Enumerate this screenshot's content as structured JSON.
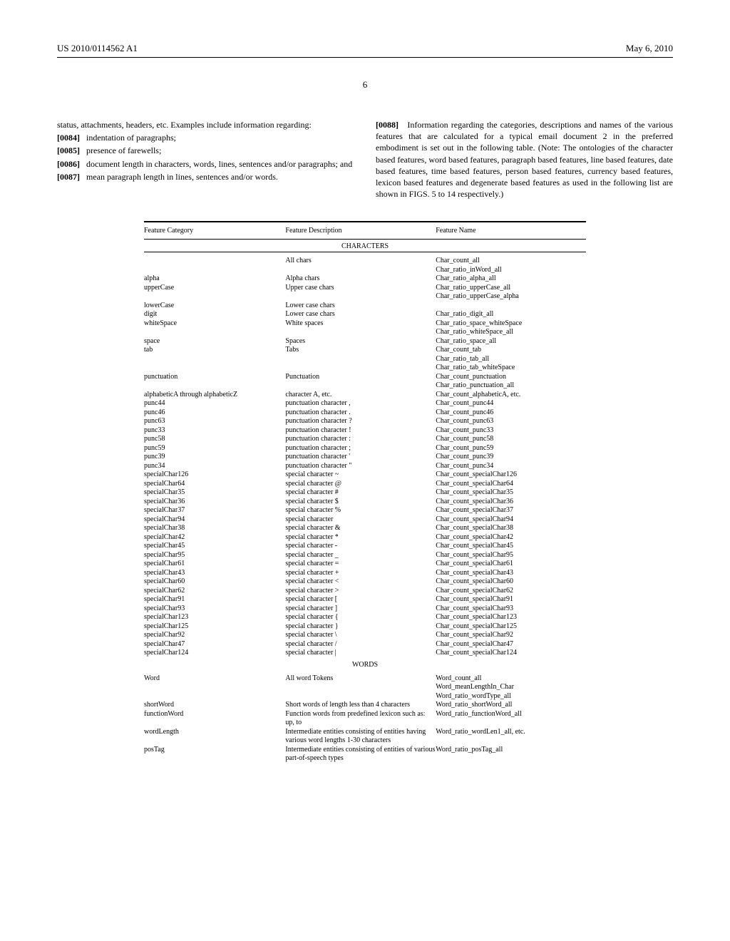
{
  "header": {
    "pub_number": "US 2010/0114562 A1",
    "pub_date": "May 6, 2010"
  },
  "page_number": "6",
  "left_column": {
    "intro": "status, attachments, headers, etc. Examples include information regarding:",
    "items": [
      {
        "num": "[0084]",
        "text": "indentation of paragraphs;"
      },
      {
        "num": "[0085]",
        "text": "presence of farewells;"
      },
      {
        "num": "[0086]",
        "text": "document length in characters, words, lines, sentences and/or paragraphs; and"
      },
      {
        "num": "[0087]",
        "text": "mean paragraph length in lines, sentences and/or words."
      }
    ]
  },
  "right_column": {
    "num": "[0088]",
    "text": "Information regarding the categories, descriptions and names of the various features that are calculated for a typical email document 2 in the preferred embodiment is set out in the following table. (Note: The ontologies of the character based features, word based features, paragraph based features, line based features, date based features, time based features, person based features, currency based features, lexicon based features and degenerate based features as used in the following list are shown in FIGS. 5 to 14 respectively.)"
  },
  "table": {
    "headers": {
      "cat": "Feature Category",
      "desc": "Feature Description",
      "name": "Feature Name"
    },
    "section_characters": "CHARACTERS",
    "section_words": "WORDS",
    "rows_characters": [
      {
        "cat": "",
        "desc": "All chars",
        "name": "Char_count_all"
      },
      {
        "cat": "",
        "desc": "",
        "name": "Char_ratio_inWord_all"
      },
      {
        "cat": "alpha",
        "desc": "Alpha chars",
        "name": "Char_ratio_alpha_all"
      },
      {
        "cat": "upperCase",
        "desc": "Upper case chars",
        "name": "Char_ratio_upperCase_all"
      },
      {
        "cat": "",
        "desc": "",
        "name": "Char_ratio_upperCase_alpha"
      },
      {
        "cat": "lowerCase",
        "desc": "Lower case chars",
        "name": ""
      },
      {
        "cat": "digit",
        "desc": "Lower case chars",
        "name": "Char_ratio_digit_all"
      },
      {
        "cat": "whiteSpace",
        "desc": "White spaces",
        "name": "Char_ratio_space_whiteSpace"
      },
      {
        "cat": "",
        "desc": "",
        "name": "Char_ratio_whiteSpace_all"
      },
      {
        "cat": "space",
        "desc": "Spaces",
        "name": "Char_ratio_space_all"
      },
      {
        "cat": "tab",
        "desc": "Tabs",
        "name": "Char_count_tab"
      },
      {
        "cat": "",
        "desc": "",
        "name": "Char_ratio_tab_all"
      },
      {
        "cat": "",
        "desc": "",
        "name": "Char_ratio_tab_whiteSpace"
      },
      {
        "cat": "punctuation",
        "desc": "Punctuation",
        "name": "Char_count_punctuation"
      },
      {
        "cat": "",
        "desc": "",
        "name": "Char_ratio_punctuation_all"
      },
      {
        "cat": "alphabeticA through alphabeticZ",
        "desc": "character A, etc.",
        "name": "Char_count_alphabeticA, etc."
      },
      {
        "cat": "punc44",
        "desc": "punctuation character ,",
        "name": "Char_count_punc44"
      },
      {
        "cat": "punc46",
        "desc": "punctuation character .",
        "name": "Char_count_punc46"
      },
      {
        "cat": "punc63",
        "desc": "punctuation character ?",
        "name": "Char_count_punc63"
      },
      {
        "cat": "punc33",
        "desc": "punctuation character !",
        "name": "Char_count_punc33"
      },
      {
        "cat": "punc58",
        "desc": "punctuation character :",
        "name": "Char_count_punc58"
      },
      {
        "cat": "punc59",
        "desc": "punctuation character ;",
        "name": "Char_count_punc59"
      },
      {
        "cat": "punc39",
        "desc": "punctuation character '",
        "name": "Char_count_punc39"
      },
      {
        "cat": "punc34",
        "desc": "punctuation character \"",
        "name": "Char_count_punc34"
      },
      {
        "cat": "specialChar126",
        "desc": "special character ~",
        "name": "Char_count_specialChar126"
      },
      {
        "cat": "specialChar64",
        "desc": "special character @",
        "name": "Char_count_specialChar64"
      },
      {
        "cat": "specialChar35",
        "desc": "special character #",
        "name": "Char_count_specialChar35"
      },
      {
        "cat": "specialChar36",
        "desc": "special character $",
        "name": "Char_count_specialChar36"
      },
      {
        "cat": "specialChar37",
        "desc": "special character %",
        "name": "Char_count_specialChar37"
      },
      {
        "cat": "specialChar94",
        "desc": "special character",
        "name": "Char_count_specialChar94"
      },
      {
        "cat": "specialChar38",
        "desc": "special character &",
        "name": "Char_count_specialChar38"
      },
      {
        "cat": "specialChar42",
        "desc": "special character *",
        "name": "Char_count_specialChar42"
      },
      {
        "cat": "specialChar45",
        "desc": "special character -",
        "name": "Char_count_specialChar45"
      },
      {
        "cat": "specialChar95",
        "desc": "special character _",
        "name": "Char_count_specialChar95"
      },
      {
        "cat": "specialChar61",
        "desc": "special character =",
        "name": "Char_count_specialChar61"
      },
      {
        "cat": "specialChar43",
        "desc": "special character +",
        "name": "Char_count_specialChar43"
      },
      {
        "cat": "specialChar60",
        "desc": "special character <",
        "name": "Char_count_specialChar60"
      },
      {
        "cat": "specialChar62",
        "desc": "special character >",
        "name": "Char_count_specialChar62"
      },
      {
        "cat": "specialChar91",
        "desc": "special character [",
        "name": "Char_count_specialChar91"
      },
      {
        "cat": "specialChar93",
        "desc": "special character ]",
        "name": "Char_count_specialChar93"
      },
      {
        "cat": "specialChar123",
        "desc": "special character {",
        "name": "Char_count_specialChar123"
      },
      {
        "cat": "specialChar125",
        "desc": "special character }",
        "name": "Char_count_specialChar125"
      },
      {
        "cat": "specialChar92",
        "desc": "special character \\",
        "name": "Char_count_specialChar92"
      },
      {
        "cat": "specialChar47",
        "desc": "special character /",
        "name": "Char_count_specialChar47"
      },
      {
        "cat": "specialChar124",
        "desc": "special character |",
        "name": "Char_count_specialChar124"
      }
    ],
    "rows_words": [
      {
        "cat": "Word",
        "desc": "All word Tokens",
        "name": "Word_count_all"
      },
      {
        "cat": "",
        "desc": "",
        "name": "Word_meanLengthIn_Char"
      },
      {
        "cat": "",
        "desc": "",
        "name": "Word_ratio_wordType_all"
      },
      {
        "cat": "shortWord",
        "desc": "Short words of length less than 4 characters",
        "name": "Word_ratio_shortWord_all"
      },
      {
        "cat": "functionWord",
        "desc": "Function words from predefined lexicon such as: up, to",
        "name": "Word_ratio_functionWord_all"
      },
      {
        "cat": "wordLength",
        "desc": "Intermediate entities consisting of entities having various word lengths 1-30 characters",
        "name": "Word_ratio_wordLen1_all, etc."
      },
      {
        "cat": "posTag",
        "desc": "Intermediate entities consisting of entities of various part-of-speech types",
        "name": "Word_ratio_posTag_all"
      }
    ]
  }
}
